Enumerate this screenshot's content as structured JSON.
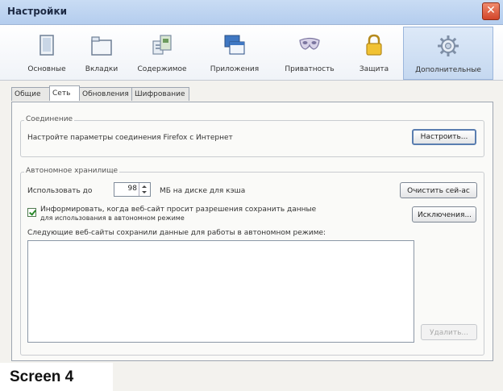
{
  "window": {
    "title": "Настройки",
    "close_glyph": "✕"
  },
  "toolbar": {
    "items": [
      {
        "label": "Основные",
        "icon": "window-icon"
      },
      {
        "label": "Вкладки",
        "icon": "tabs-icon"
      },
      {
        "label": "Содержимое",
        "icon": "content-icon"
      },
      {
        "label": "Приложения",
        "icon": "applications-icon"
      },
      {
        "label": "Приватность",
        "icon": "mask-icon"
      },
      {
        "label": "Защита",
        "icon": "lock-icon"
      },
      {
        "label": "Дополнительные",
        "icon": "gear-icon"
      }
    ],
    "active_index": 6
  },
  "subtabs": {
    "items": [
      {
        "label": "Общие"
      },
      {
        "label": "Сеть"
      },
      {
        "label": "Обновления"
      },
      {
        "label": "Шифрование"
      }
    ],
    "active_index": 1
  },
  "connection": {
    "title": "Соединение",
    "description": "Настройте параметры соединения Firefox с Интернет",
    "configure_button": "Настроить..."
  },
  "offline": {
    "title": "Автономное хранилище",
    "use_up_to_label": "Использовать до",
    "cache_value": "98",
    "cache_units_label": "МБ на диске для кэша",
    "clear_button": "Очистить сей-ас",
    "notify_checked": true,
    "notify_line1": "Информировать, когда веб-сайт просит разрешения сохранить данные",
    "notify_line2": "для использования в автономном режиме",
    "exceptions_button": "Исключения...",
    "sites_label": "Следующие веб-сайты сохранили данные для работы в автономном режиме:",
    "remove_button": "Удалить..."
  },
  "caption": "Screen 4"
}
